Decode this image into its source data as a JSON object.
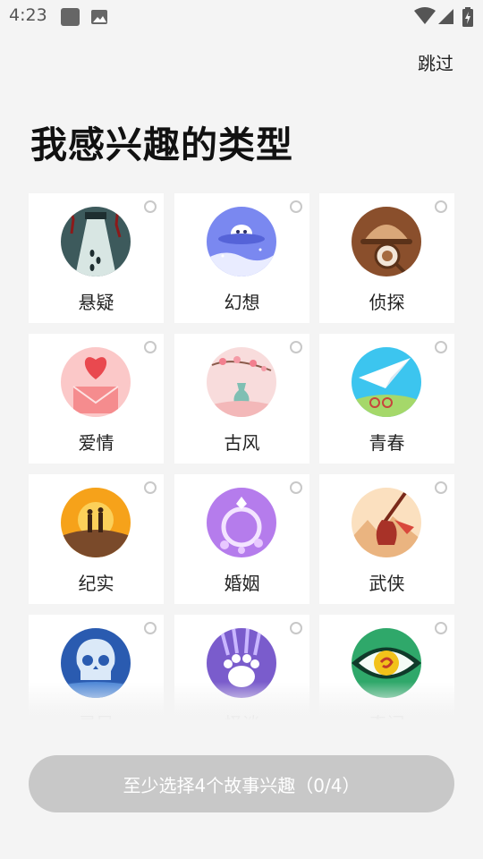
{
  "status_bar": {
    "time": "4:23"
  },
  "header": {
    "skip_label": "跳过",
    "title": "我感兴趣的类型"
  },
  "genres": [
    {
      "label": "悬疑",
      "icon": "suspense-icon",
      "selected": false
    },
    {
      "label": "幻想",
      "icon": "ufo-fantasy-icon",
      "selected": false
    },
    {
      "label": "侦探",
      "icon": "detective-hat-icon",
      "selected": false
    },
    {
      "label": "爱情",
      "icon": "heart-love-icon",
      "selected": false
    },
    {
      "label": "古风",
      "icon": "blossom-vase-icon",
      "selected": false
    },
    {
      "label": "青春",
      "icon": "paper-plane-icon",
      "selected": false
    },
    {
      "label": "纪实",
      "icon": "sunset-people-icon",
      "selected": false
    },
    {
      "label": "婚姻",
      "icon": "ring-icon",
      "selected": false
    },
    {
      "label": "武侠",
      "icon": "sword-icon",
      "selected": false
    },
    {
      "label": "灵异",
      "icon": "skull-icon",
      "selected": false
    },
    {
      "label": "怪谈",
      "icon": "claw-icon",
      "selected": false
    },
    {
      "label": "奇闻",
      "icon": "eye-icon",
      "selected": false
    }
  ],
  "footer": {
    "cta_label": "至少选择4个故事兴趣（0/4）",
    "selected_count": 0,
    "required_count": 4
  },
  "colors": {
    "background": "#f4f4f4",
    "card": "#ffffff",
    "cta_disabled": "#c8c8c8"
  }
}
